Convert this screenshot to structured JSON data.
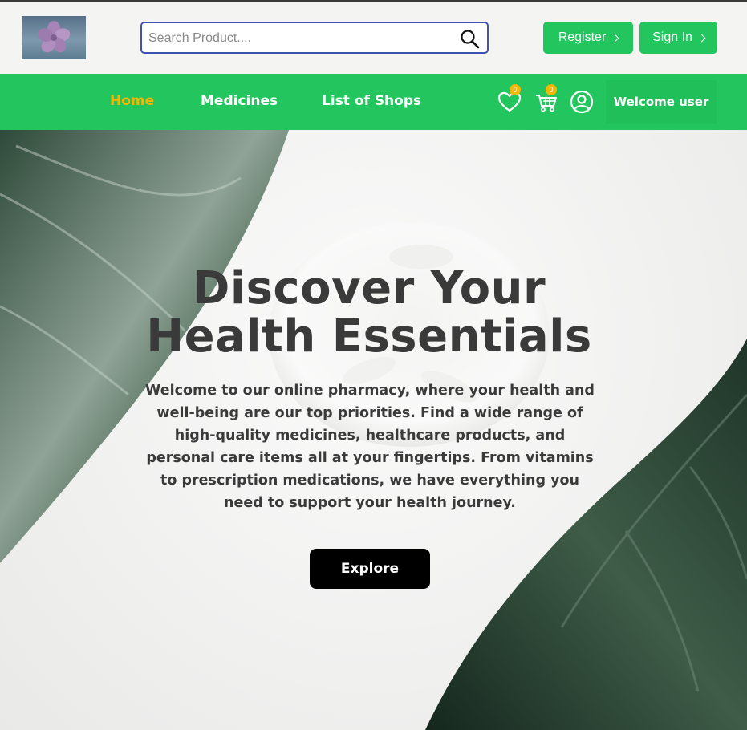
{
  "header": {
    "logo_icon": "flower-logo",
    "search": {
      "placeholder": "Search Product...."
    },
    "register_label": "Register",
    "signin_label": "Sign In"
  },
  "nav": {
    "items": [
      {
        "label": "Home",
        "active": true
      },
      {
        "label": "Medicines",
        "active": false
      },
      {
        "label": "List of Shops",
        "active": false
      }
    ],
    "wishlist_count": "0",
    "cart_count": "0",
    "welcome_label": "Welcome user"
  },
  "hero": {
    "title_line1": "Discover Your",
    "title_line2": "Health Essentials",
    "description": "Welcome to our online pharmacy, where your health and well-being are our top priorities. Find a wide range of high-quality medicines, healthcare products, and personal care items all at your fingertips. From vitamins to prescription medications, we have everything you need to support your health journey.",
    "explore_label": "Explore"
  },
  "colors": {
    "brand_green": "#22c55e",
    "active_nav": "#f5b700",
    "search_border": "#3f51b5",
    "text_dark": "#3a3a3a"
  }
}
